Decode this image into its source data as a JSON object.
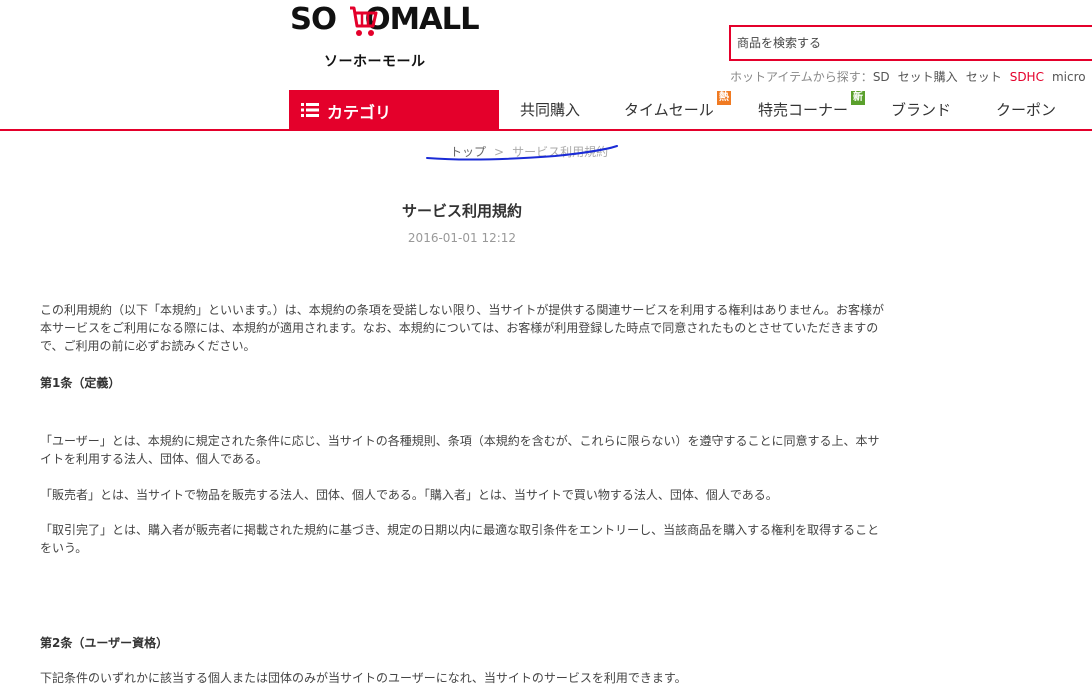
{
  "header": {
    "logo_text": "SOHOMALL",
    "logo_subtitle": "ソーホーモール",
    "search_placeholder": "商品を検索する",
    "hot_label": "ホットアイテムから探す：",
    "hot_items": [
      {
        "label": "SD",
        "highlight": false
      },
      {
        "label": "セット購入",
        "highlight": false
      },
      {
        "label": "セット",
        "highlight": false
      },
      {
        "label": "SDHC",
        "highlight": true
      },
      {
        "label": "micro",
        "highlight": false
      }
    ]
  },
  "nav": {
    "category_label": "カテゴリ",
    "items": [
      {
        "label": "共同購入"
      },
      {
        "label": "タイムセール",
        "badge": "熱",
        "badge_color": "#f07a22"
      },
      {
        "label": "特売コーナー",
        "badge": "新",
        "badge_color": "#5aa02c"
      },
      {
        "label": "ブランド"
      },
      {
        "label": "クーポン"
      }
    ]
  },
  "breadcrumb": {
    "home": "トップ",
    "separator": ">",
    "current": "サービス利用規約"
  },
  "article": {
    "title": "サービス利用規約",
    "date": "2016-01-01 12:12",
    "intro": "この利用規約（以下「本規約」といいます。）は、本規約の条項を受諾しない限り、当サイトが提供する関連サービスを利用する権利はありません。お客様が本サービスをご利用になる際には、本規約が適用されます。なお、本規約については、お客様が利用登録した時点で同意されたものとさせていただきますので、ご利用の前に必ずお読みください。",
    "section1_heading": "第1条（定義）",
    "section1_p1": "「ユーザー」とは、本規約に規定された条件に応じ、当サイトの各種規則、条項（本規約を含むが、これらに限らない）を遵守することに同意する上、本サイトを利用する法人、団体、個人である。",
    "section1_p2": "「販売者」とは、当サイトで物品を販売する法人、団体、個人である。「購入者」とは、当サイトで買い物する法人、団体、個人である。",
    "section1_p3": "「取引完了」とは、購入者が販売者に掲載された規約に基づき、規定の日期以内に最適な取引条件をエントリーし、当該商品を購入する権利を取得することをいう。",
    "section2_heading": "第2条（ユーザー資格）",
    "section2_p1": "下記条件のいずれかに該当する個人または団体のみが当サイトのユーザーになれ、当サイトのサービスを利用できます。"
  },
  "colors": {
    "brand_red": "#e4002b",
    "annotation_blue": "#1a2bd6"
  }
}
